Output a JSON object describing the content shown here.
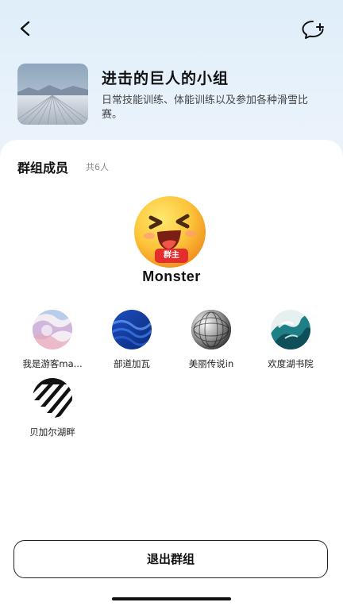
{
  "header": {
    "back_icon": "chevron-left-icon",
    "chat_icon": "chat-add-icon"
  },
  "group": {
    "title": "进击的巨人的小组",
    "description": "日常技能训练、体能训练以及参加各种滑雪比赛。"
  },
  "members_section": {
    "heading": "群组成员",
    "count": "共6人"
  },
  "owner": {
    "badge": "群主",
    "name": "Monster"
  },
  "members": [
    {
      "name": "我是游客ma..."
    },
    {
      "name": "部道加瓦"
    },
    {
      "name": "美丽传说in"
    },
    {
      "name": "欢度湖书院"
    },
    {
      "name": "贝加尔湖畔"
    }
  ],
  "actions": {
    "exit_label": "退出群组"
  },
  "colors": {
    "owner_badge": "#e62d2d",
    "background_top": "#dfeefa"
  }
}
